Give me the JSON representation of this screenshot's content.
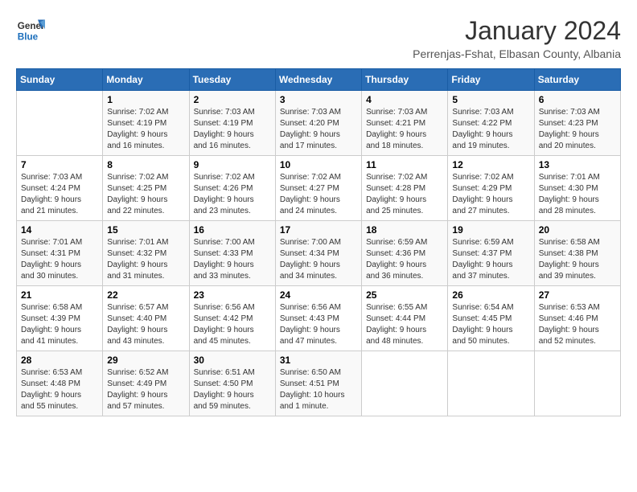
{
  "header": {
    "logo_line1": "General",
    "logo_line2": "Blue",
    "month_title": "January 2024",
    "subtitle": "Perrenjas-Fshat, Elbasan County, Albania"
  },
  "days_of_week": [
    "Sunday",
    "Monday",
    "Tuesday",
    "Wednesday",
    "Thursday",
    "Friday",
    "Saturday"
  ],
  "weeks": [
    [
      {
        "day": "",
        "info": ""
      },
      {
        "day": "1",
        "info": "Sunrise: 7:02 AM\nSunset: 4:19 PM\nDaylight: 9 hours\nand 16 minutes."
      },
      {
        "day": "2",
        "info": "Sunrise: 7:03 AM\nSunset: 4:19 PM\nDaylight: 9 hours\nand 16 minutes."
      },
      {
        "day": "3",
        "info": "Sunrise: 7:03 AM\nSunset: 4:20 PM\nDaylight: 9 hours\nand 17 minutes."
      },
      {
        "day": "4",
        "info": "Sunrise: 7:03 AM\nSunset: 4:21 PM\nDaylight: 9 hours\nand 18 minutes."
      },
      {
        "day": "5",
        "info": "Sunrise: 7:03 AM\nSunset: 4:22 PM\nDaylight: 9 hours\nand 19 minutes."
      },
      {
        "day": "6",
        "info": "Sunrise: 7:03 AM\nSunset: 4:23 PM\nDaylight: 9 hours\nand 20 minutes."
      }
    ],
    [
      {
        "day": "7",
        "info": "Sunrise: 7:03 AM\nSunset: 4:24 PM\nDaylight: 9 hours\nand 21 minutes."
      },
      {
        "day": "8",
        "info": "Sunrise: 7:02 AM\nSunset: 4:25 PM\nDaylight: 9 hours\nand 22 minutes."
      },
      {
        "day": "9",
        "info": "Sunrise: 7:02 AM\nSunset: 4:26 PM\nDaylight: 9 hours\nand 23 minutes."
      },
      {
        "day": "10",
        "info": "Sunrise: 7:02 AM\nSunset: 4:27 PM\nDaylight: 9 hours\nand 24 minutes."
      },
      {
        "day": "11",
        "info": "Sunrise: 7:02 AM\nSunset: 4:28 PM\nDaylight: 9 hours\nand 25 minutes."
      },
      {
        "day": "12",
        "info": "Sunrise: 7:02 AM\nSunset: 4:29 PM\nDaylight: 9 hours\nand 27 minutes."
      },
      {
        "day": "13",
        "info": "Sunrise: 7:01 AM\nSunset: 4:30 PM\nDaylight: 9 hours\nand 28 minutes."
      }
    ],
    [
      {
        "day": "14",
        "info": "Sunrise: 7:01 AM\nSunset: 4:31 PM\nDaylight: 9 hours\nand 30 minutes."
      },
      {
        "day": "15",
        "info": "Sunrise: 7:01 AM\nSunset: 4:32 PM\nDaylight: 9 hours\nand 31 minutes."
      },
      {
        "day": "16",
        "info": "Sunrise: 7:00 AM\nSunset: 4:33 PM\nDaylight: 9 hours\nand 33 minutes."
      },
      {
        "day": "17",
        "info": "Sunrise: 7:00 AM\nSunset: 4:34 PM\nDaylight: 9 hours\nand 34 minutes."
      },
      {
        "day": "18",
        "info": "Sunrise: 6:59 AM\nSunset: 4:36 PM\nDaylight: 9 hours\nand 36 minutes."
      },
      {
        "day": "19",
        "info": "Sunrise: 6:59 AM\nSunset: 4:37 PM\nDaylight: 9 hours\nand 37 minutes."
      },
      {
        "day": "20",
        "info": "Sunrise: 6:58 AM\nSunset: 4:38 PM\nDaylight: 9 hours\nand 39 minutes."
      }
    ],
    [
      {
        "day": "21",
        "info": "Sunrise: 6:58 AM\nSunset: 4:39 PM\nDaylight: 9 hours\nand 41 minutes."
      },
      {
        "day": "22",
        "info": "Sunrise: 6:57 AM\nSunset: 4:40 PM\nDaylight: 9 hours\nand 43 minutes."
      },
      {
        "day": "23",
        "info": "Sunrise: 6:56 AM\nSunset: 4:42 PM\nDaylight: 9 hours\nand 45 minutes."
      },
      {
        "day": "24",
        "info": "Sunrise: 6:56 AM\nSunset: 4:43 PM\nDaylight: 9 hours\nand 47 minutes."
      },
      {
        "day": "25",
        "info": "Sunrise: 6:55 AM\nSunset: 4:44 PM\nDaylight: 9 hours\nand 48 minutes."
      },
      {
        "day": "26",
        "info": "Sunrise: 6:54 AM\nSunset: 4:45 PM\nDaylight: 9 hours\nand 50 minutes."
      },
      {
        "day": "27",
        "info": "Sunrise: 6:53 AM\nSunset: 4:46 PM\nDaylight: 9 hours\nand 52 minutes."
      }
    ],
    [
      {
        "day": "28",
        "info": "Sunrise: 6:53 AM\nSunset: 4:48 PM\nDaylight: 9 hours\nand 55 minutes."
      },
      {
        "day": "29",
        "info": "Sunrise: 6:52 AM\nSunset: 4:49 PM\nDaylight: 9 hours\nand 57 minutes."
      },
      {
        "day": "30",
        "info": "Sunrise: 6:51 AM\nSunset: 4:50 PM\nDaylight: 9 hours\nand 59 minutes."
      },
      {
        "day": "31",
        "info": "Sunrise: 6:50 AM\nSunset: 4:51 PM\nDaylight: 10 hours\nand 1 minute."
      },
      {
        "day": "",
        "info": ""
      },
      {
        "day": "",
        "info": ""
      },
      {
        "day": "",
        "info": ""
      }
    ]
  ]
}
